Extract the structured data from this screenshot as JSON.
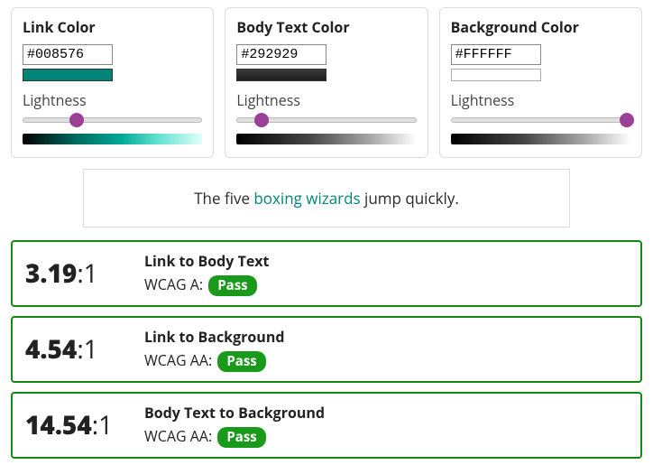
{
  "panels": {
    "link": {
      "title": "Link Color",
      "hex": "#008576",
      "lightness_label": "Lightness",
      "thumb_pct": 30
    },
    "body": {
      "title": "Body Text Color",
      "hex": "#292929",
      "lightness_label": "Lightness",
      "thumb_pct": 14
    },
    "bg": {
      "title": "Background Color",
      "hex": "#FFFFFF",
      "lightness_label": "Lightness",
      "thumb_pct": 98
    }
  },
  "sample": {
    "before": "The five ",
    "link_text": "boxing wizards",
    "after": " jump quickly."
  },
  "results": [
    {
      "ratio": "3.19",
      "denom": ":1",
      "title": "Link to Body Text",
      "wcag_prefix": "WCAG A: ",
      "status": "Pass"
    },
    {
      "ratio": "4.54",
      "denom": ":1",
      "title": "Link to Background",
      "wcag_prefix": "WCAG AA: ",
      "status": "Pass"
    },
    {
      "ratio": "14.54",
      "denom": ":1",
      "title": "Body Text to Background",
      "wcag_prefix": "WCAG AA: ",
      "status": "Pass"
    }
  ]
}
